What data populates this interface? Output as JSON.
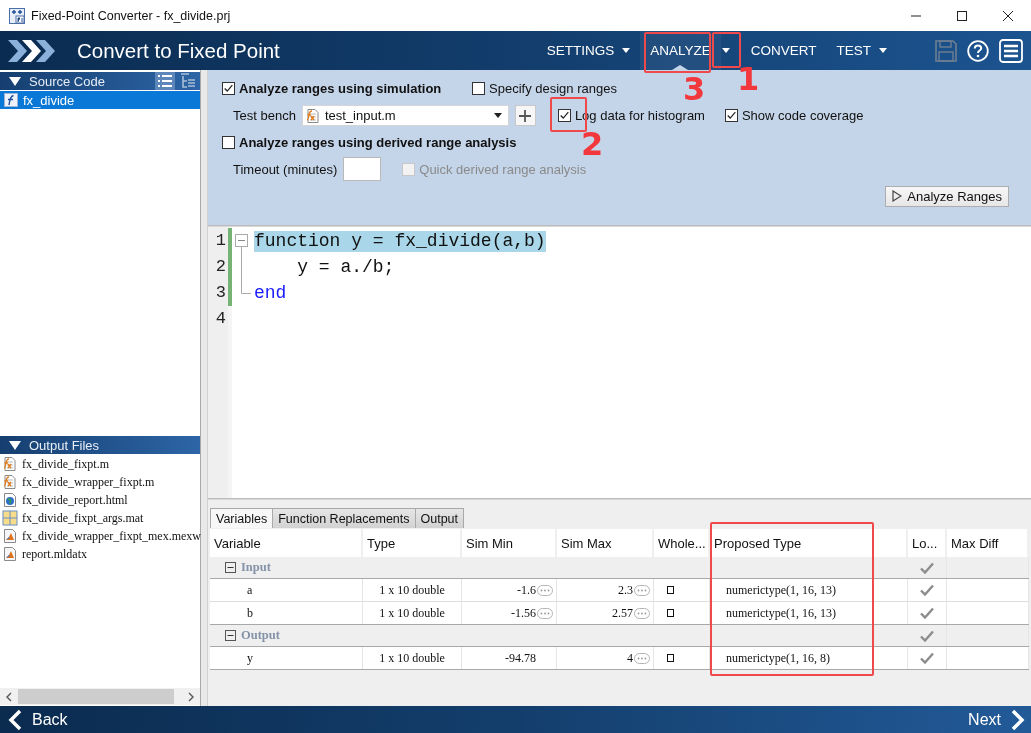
{
  "window": {
    "title": "Fixed-Point Converter - fx_divide.prj"
  },
  "header": {
    "title": "Convert to Fixed Point",
    "menu": [
      {
        "label": "SETTINGS",
        "kind": "dropdown",
        "selected": false,
        "marked": false
      },
      {
        "label": "ANALYZE",
        "kind": "plain",
        "selected": true,
        "marked": true
      },
      {
        "kind": "caret",
        "selected": false,
        "marked": true
      },
      {
        "label": "CONVERT",
        "kind": "plain",
        "selected": false,
        "marked": false
      },
      {
        "label": "TEST",
        "kind": "dropdown",
        "selected": false,
        "marked": false
      }
    ],
    "tools": [
      {
        "kind": "save",
        "disabled": true
      },
      {
        "kind": "help",
        "disabled": false
      },
      {
        "kind": "menu",
        "disabled": false
      }
    ]
  },
  "source_code": {
    "title": "Source Code",
    "expanded": true,
    "views": [
      {
        "kind": "list",
        "selected": true
      },
      {
        "kind": "tree",
        "selected": false
      }
    ],
    "items": [
      {
        "label": "fx_divide",
        "selected": true
      }
    ]
  },
  "output_files": {
    "title": "Output Files",
    "expanded": true,
    "items": [
      {
        "label": "fx_divide_fixpt.m",
        "kind": "mfile"
      },
      {
        "label": "fx_divide_wrapper_fixpt.m",
        "kind": "mfile"
      },
      {
        "label": "fx_divide_report.html",
        "kind": "html"
      },
      {
        "label": "fx_divide_fixpt_args.mat",
        "kind": "mat"
      },
      {
        "label": "fx_divide_wrapper_fixpt_mex.mexw",
        "kind": "mex"
      },
      {
        "label": "report.mldatx",
        "kind": "mex"
      }
    ]
  },
  "analyze": {
    "simulation": {
      "label": "Analyze ranges using simulation",
      "checked": true
    },
    "design_ranges": {
      "label": "Specify design ranges",
      "checked": false
    },
    "test_bench": {
      "label": "Test bench",
      "value": "test_input.m"
    },
    "log_histogram": {
      "label": "Log data for histogram",
      "checked": true,
      "marked": true
    },
    "code_coverage": {
      "label": "Show code coverage",
      "checked": true
    },
    "derived": {
      "label": "Analyze ranges using derived range analysis",
      "checked": false
    },
    "timeout": {
      "label": "Timeout (minutes)"
    },
    "quick_derived": {
      "label": "Quick derived range analysis",
      "checked": false,
      "disabled": true
    },
    "button": "Analyze Ranges"
  },
  "code": {
    "lines": [
      {
        "number": "1",
        "kind": "foldstart",
        "tokens": [
          {
            "text": "function y = fx_divide(a,b)",
            "kind": "plain"
          }
        ],
        "highlighted": true,
        "covered": true
      },
      {
        "number": "2",
        "kind": "foldbody",
        "tokens": [
          {
            "text": "    y = a./b;",
            "kind": "plain"
          }
        ],
        "highlighted": false,
        "covered": true
      },
      {
        "number": "3",
        "kind": "foldend",
        "tokens": [
          {
            "text": "end",
            "kind": "keyword"
          }
        ],
        "highlighted": false,
        "covered": true
      },
      {
        "number": "4",
        "kind": "plain",
        "covered": false
      }
    ]
  },
  "results": {
    "tabs": [
      {
        "label": "Variables",
        "selected": true
      },
      {
        "label": "Function Replacements",
        "selected": false
      },
      {
        "label": "Output",
        "selected": false
      }
    ],
    "columns": [
      {
        "label": "Variable",
        "marked": false
      },
      {
        "label": "Type",
        "marked": false
      },
      {
        "label": "Sim Min",
        "marked": false
      },
      {
        "label": "Sim Max",
        "marked": false
      },
      {
        "label": "Whole...",
        "marked": false
      },
      {
        "label": "Proposed Type",
        "marked": true
      },
      {
        "label": "Lo...",
        "marked": false
      },
      {
        "label": "Max Diff",
        "marked": false
      }
    ],
    "groups": [
      {
        "label": "Input",
        "expanded": true,
        "log": true,
        "children": [
          {
            "variable": "a",
            "type": "1 x 10 double",
            "sim_min": "-1.6",
            "sim_min_more": true,
            "sim_max": "2.3",
            "sim_max_more": true,
            "whole": false,
            "proposed_type": "numerictype(1, 16, 13)",
            "log": true
          },
          {
            "variable": "b",
            "type": "1 x 10 double",
            "sim_min": "-1.56",
            "sim_min_more": true,
            "sim_max": "2.57",
            "sim_max_more": true,
            "whole": false,
            "proposed_type": "numerictype(1, 16, 13)",
            "log": true
          }
        ]
      },
      {
        "label": "Output",
        "expanded": true,
        "log": true,
        "children": [
          {
            "variable": "y",
            "type": "1 x 10 double",
            "sim_min": "-94.78",
            "sim_min_more": false,
            "sim_max": "4",
            "sim_max_more": true,
            "whole": false,
            "proposed_type": "numerictype(1, 16, 8)",
            "log": true
          }
        ]
      }
    ]
  },
  "annotations": [
    "1",
    "2",
    "3"
  ],
  "footer": {
    "back": "Back",
    "next": "Next"
  }
}
